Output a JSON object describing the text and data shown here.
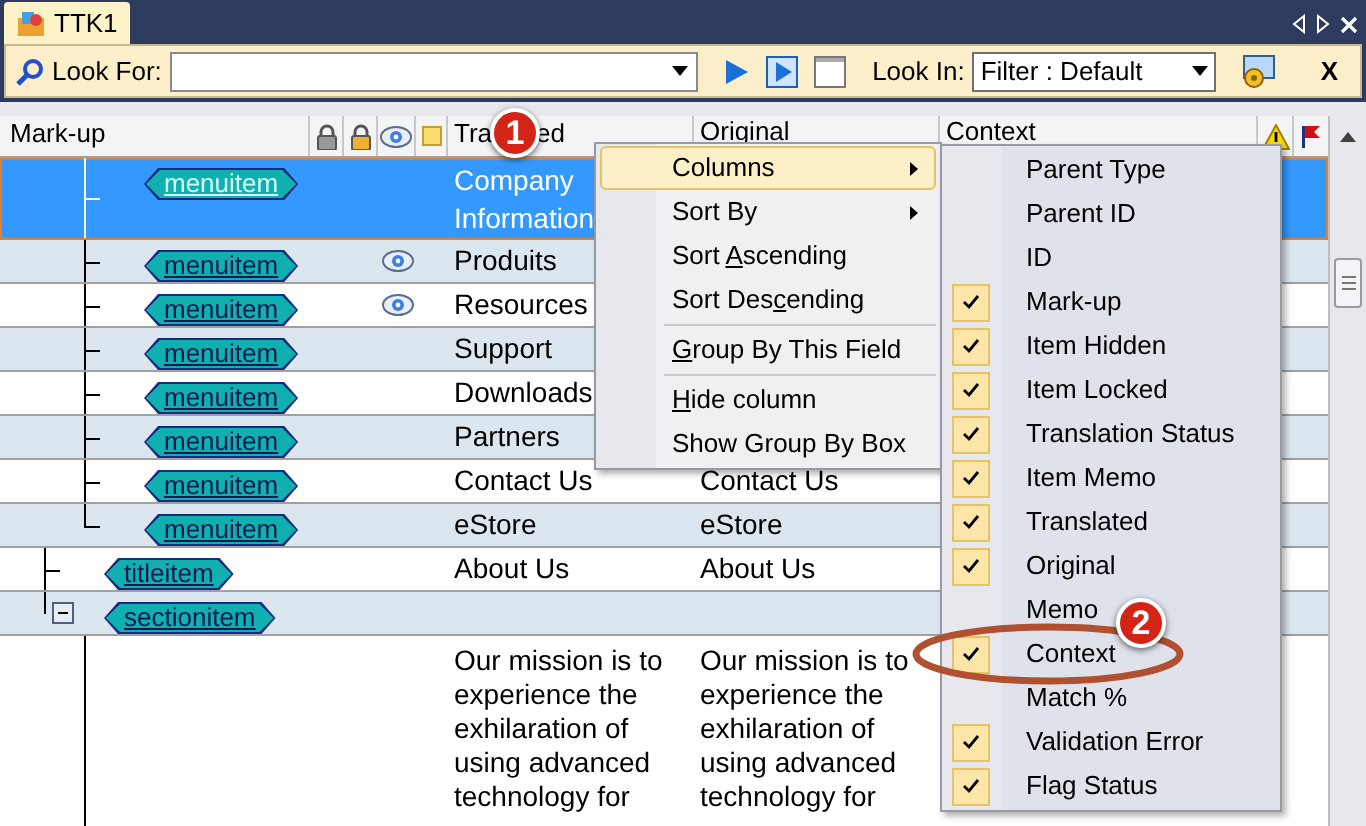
{
  "tab": {
    "label": "TTK1"
  },
  "toolbar": {
    "look_for_label": "Look For:",
    "look_in_label": "Look In:",
    "look_in_value": "Filter : Default",
    "close_label": "X"
  },
  "table": {
    "columns": [
      {
        "texts": [
          "Mark-up"
        ]
      },
      {
        "texts": [
          "Tra",
          "ed"
        ]
      },
      {
        "texts": [
          "Original"
        ]
      },
      {
        "texts": [
          "Context"
        ]
      }
    ],
    "tree": [
      {
        "children": [
          {
            "tag": "menuitem",
            "hidden": false,
            "selected": true,
            "translated": "Company Information"
          },
          {
            "tag": "menuitem",
            "hidden": true,
            "selected": false,
            "translated": "Produits"
          },
          {
            "tag": "menuitem",
            "hidden": true,
            "selected": false,
            "translated": "Resources"
          },
          {
            "tag": "menuitem",
            "hidden": false,
            "selected": false,
            "translated": "Support"
          },
          {
            "tag": "menuitem",
            "hidden": false,
            "selected": false,
            "translated": "Downloads"
          },
          {
            "tag": "menuitem",
            "hidden": false,
            "selected": false,
            "translated": "Partners"
          },
          {
            "tag": "menuitem",
            "hidden": false,
            "selected": false,
            "translated": "Contact Us",
            "original": "Contact Us"
          },
          {
            "tag": "menuitem",
            "hidden": false,
            "selected": false,
            "translated": "eStore",
            "original": "eStore"
          }
        ]
      },
      {
        "tag": "titleitem",
        "hidden": false,
        "selected": false,
        "translated": "About Us",
        "original": "About Us"
      },
      {
        "tag": "sectionitem",
        "hidden": false,
        "selected": false,
        "expanded": true,
        "children": [
          {
            "hidden": false,
            "selected": false,
            "translated": "Our mission is to experience the exhilaration of using advanced technology for",
            "original": "Our mission is to experience the exhilaration of using advanced technology for"
          }
        ]
      }
    ]
  },
  "context_menu": {
    "items": [
      {
        "parts": [
          {
            "text": "Columns",
            "underline": false
          }
        ],
        "submenu": true,
        "selected": true,
        "separator_before": false
      },
      {
        "parts": [
          {
            "text": "Sort By",
            "underline": false
          }
        ],
        "submenu": true,
        "selected": false,
        "separator_before": false
      },
      {
        "parts": [
          {
            "text": "Sort ",
            "underline": false
          },
          {
            "text": "A",
            "underline": true
          },
          {
            "text": "scending",
            "underline": false
          }
        ],
        "submenu": false,
        "selected": false,
        "separator_before": false
      },
      {
        "parts": [
          {
            "text": "Sort Des",
            "underline": false
          },
          {
            "text": "c",
            "underline": true
          },
          {
            "text": "ending",
            "underline": false
          }
        ],
        "submenu": false,
        "selected": false,
        "separator_before": false
      },
      {
        "parts": [
          {
            "text": "G",
            "underline": true
          },
          {
            "text": "roup By This Field",
            "underline": false
          }
        ],
        "submenu": false,
        "selected": false,
        "separator_before": true
      },
      {
        "parts": [
          {
            "text": "H",
            "underline": true
          },
          {
            "text": "ide column",
            "underline": false
          }
        ],
        "submenu": false,
        "selected": false,
        "separator_before": true
      },
      {
        "parts": [
          {
            "text": "Show Group By Box",
            "underline": false
          }
        ],
        "submenu": false,
        "selected": false,
        "separator_before": false
      }
    ]
  },
  "columns_submenu": {
    "items": [
      {
        "label": "Parent Type",
        "checked": false
      },
      {
        "label": "Parent ID",
        "checked": false
      },
      {
        "label": "ID",
        "checked": false
      },
      {
        "label": "Mark-up",
        "checked": true
      },
      {
        "label": "Item Hidden",
        "checked": true
      },
      {
        "label": "Item Locked",
        "checked": true
      },
      {
        "label": "Translation Status",
        "checked": true
      },
      {
        "label": "Item Memo",
        "checked": true
      },
      {
        "label": "Translated",
        "checked": true
      },
      {
        "label": "Original",
        "checked": true
      },
      {
        "label": "Memo",
        "checked": false
      },
      {
        "label": "Context",
        "checked": true,
        "circled": true
      },
      {
        "label": "Match %",
        "checked": false
      },
      {
        "label": "Validation Error",
        "checked": true
      },
      {
        "label": "Flag Status",
        "checked": true
      }
    ]
  },
  "callouts": [
    {
      "text": "1"
    },
    {
      "text": "2"
    }
  ]
}
